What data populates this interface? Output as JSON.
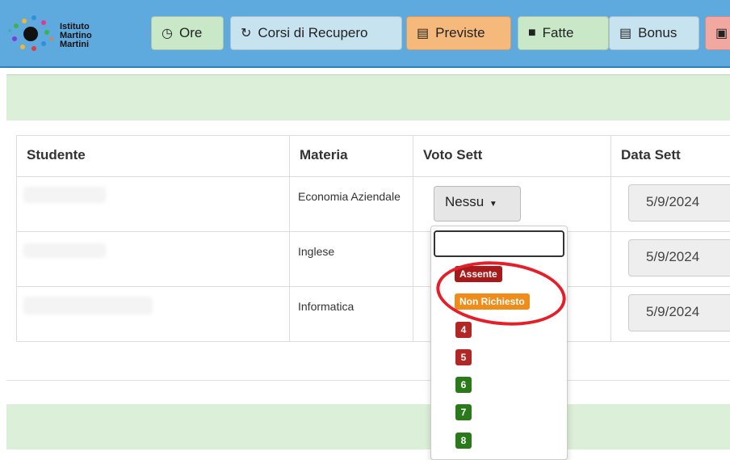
{
  "logo": {
    "line1": "Istituto",
    "line2": "Martino",
    "line3": "Martini"
  },
  "nav": {
    "ore": {
      "label": "Ore",
      "icon": "clock-icon"
    },
    "corsi": {
      "label": "Corsi di Recupero",
      "icon": "refresh-icon"
    },
    "previste": {
      "label": "Previste",
      "icon": "list-icon"
    },
    "fatte": {
      "label": "Fatte",
      "icon": "folder-icon"
    },
    "bonus": {
      "label": "Bonus",
      "icon": "list-icon"
    }
  },
  "table": {
    "headers": {
      "studente": "Studente",
      "materia": "Materia",
      "voto": "Voto Sett",
      "data": "Data Sett"
    },
    "rows": [
      {
        "materia": "Economia Aziendale",
        "voto": "Nessu",
        "data": "5/9/2024"
      },
      {
        "materia": "Inglese",
        "data": "5/9/2024"
      },
      {
        "materia": "Informatica",
        "data": "5/9/2024"
      }
    ]
  },
  "dropdown": {
    "options": {
      "assente": "Assente",
      "non_richiesto": "Non Richiesto",
      "n4": "4",
      "n5": "5",
      "n6": "6",
      "n7": "7",
      "n8": "8"
    }
  },
  "colors": {
    "navbar": "#5ea9dd",
    "green_band": "#dcefd8",
    "assente": "#a81a1a",
    "non_richiesto": "#f08c1a",
    "insufficient": "#b32626",
    "sufficient": "#2a7a1c",
    "annotation": "#e51f2a"
  }
}
